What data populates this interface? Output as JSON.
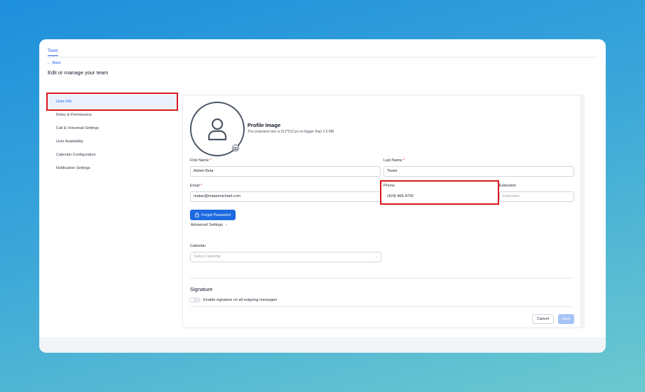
{
  "tabs": [
    "Team"
  ],
  "back_label": "Back",
  "page_title": "Edit or manage your team",
  "sidebar": {
    "items": [
      {
        "label": "User Info",
        "active": true
      },
      {
        "label": "Roles & Permissions"
      },
      {
        "label": "Call & Voicemail Settings"
      },
      {
        "label": "User Availability"
      },
      {
        "label": "Calendar Configuration"
      },
      {
        "label": "Notification Settings"
      }
    ]
  },
  "profile": {
    "title": "Profile Image",
    "hint": "The proposed size is 512*512 px no bigger than 2.5 MB"
  },
  "form": {
    "first_name": {
      "label": "First Name",
      "value": "Admin Beta"
    },
    "last_name": {
      "label": "Last Name",
      "value": "Tester"
    },
    "email": {
      "label": "Email",
      "value": "matan@matanmichael.com"
    },
    "phone": {
      "label": "Phone",
      "value": "(424) 466-4700"
    },
    "extension": {
      "label": "Extension",
      "placeholder": "Extension"
    },
    "required_mark": "*"
  },
  "forgot_password_label": "Forgot Password",
  "advanced_settings_label": "Advanced Settings",
  "calendar": {
    "label": "Calendar",
    "placeholder": "Select Calendar"
  },
  "signature": {
    "title": "Signature",
    "toggle_label": "Enable signature on all outgoing messages",
    "enabled": false
  },
  "actions": {
    "cancel": "Cancel",
    "save": "Save"
  },
  "colors": {
    "accent": "#2563eb",
    "highlight": "#d9161c",
    "required": "#dc2626"
  }
}
